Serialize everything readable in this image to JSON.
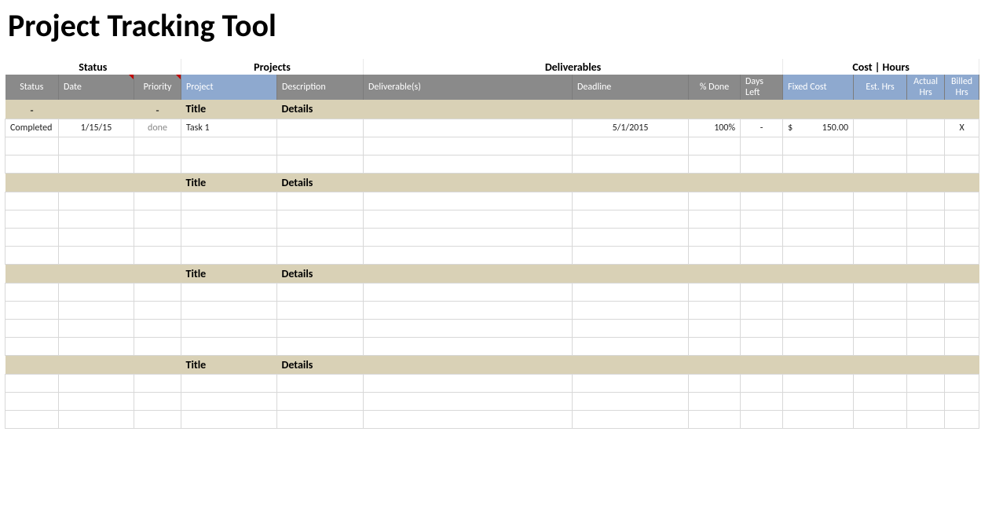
{
  "title": "Project Tracking Tool",
  "groups": {
    "status": "Status",
    "projects": "Projects",
    "deliverables": "Deliverables",
    "cost_hours": "Cost | Hours"
  },
  "headers": {
    "status": "Status",
    "date": "Date",
    "priority": "Priority",
    "project": "Project",
    "description": "Description",
    "deliverables": "Deliverable(s)",
    "deadline": "Deadline",
    "pct_done": "% Done",
    "days_left": "Days Left",
    "fixed_cost": "Fixed Cost",
    "est_hrs": "Est. Hrs",
    "actual_hrs": "Actual Hrs",
    "billed_hrs": "Billed Hrs"
  },
  "section_labels": {
    "dash": "-",
    "title": "Title",
    "details": "Details"
  },
  "data_row": {
    "status": "Completed",
    "date": "1/15/15",
    "priority": "done",
    "project": "Task 1",
    "description": "",
    "deliverables": "",
    "deadline": "5/1/2015",
    "pct_done": "100%",
    "days_left": "-",
    "cost_symbol": "$",
    "cost_value": "150.00",
    "est_hrs": "",
    "actual_hrs": "",
    "billed_hrs": "X"
  }
}
